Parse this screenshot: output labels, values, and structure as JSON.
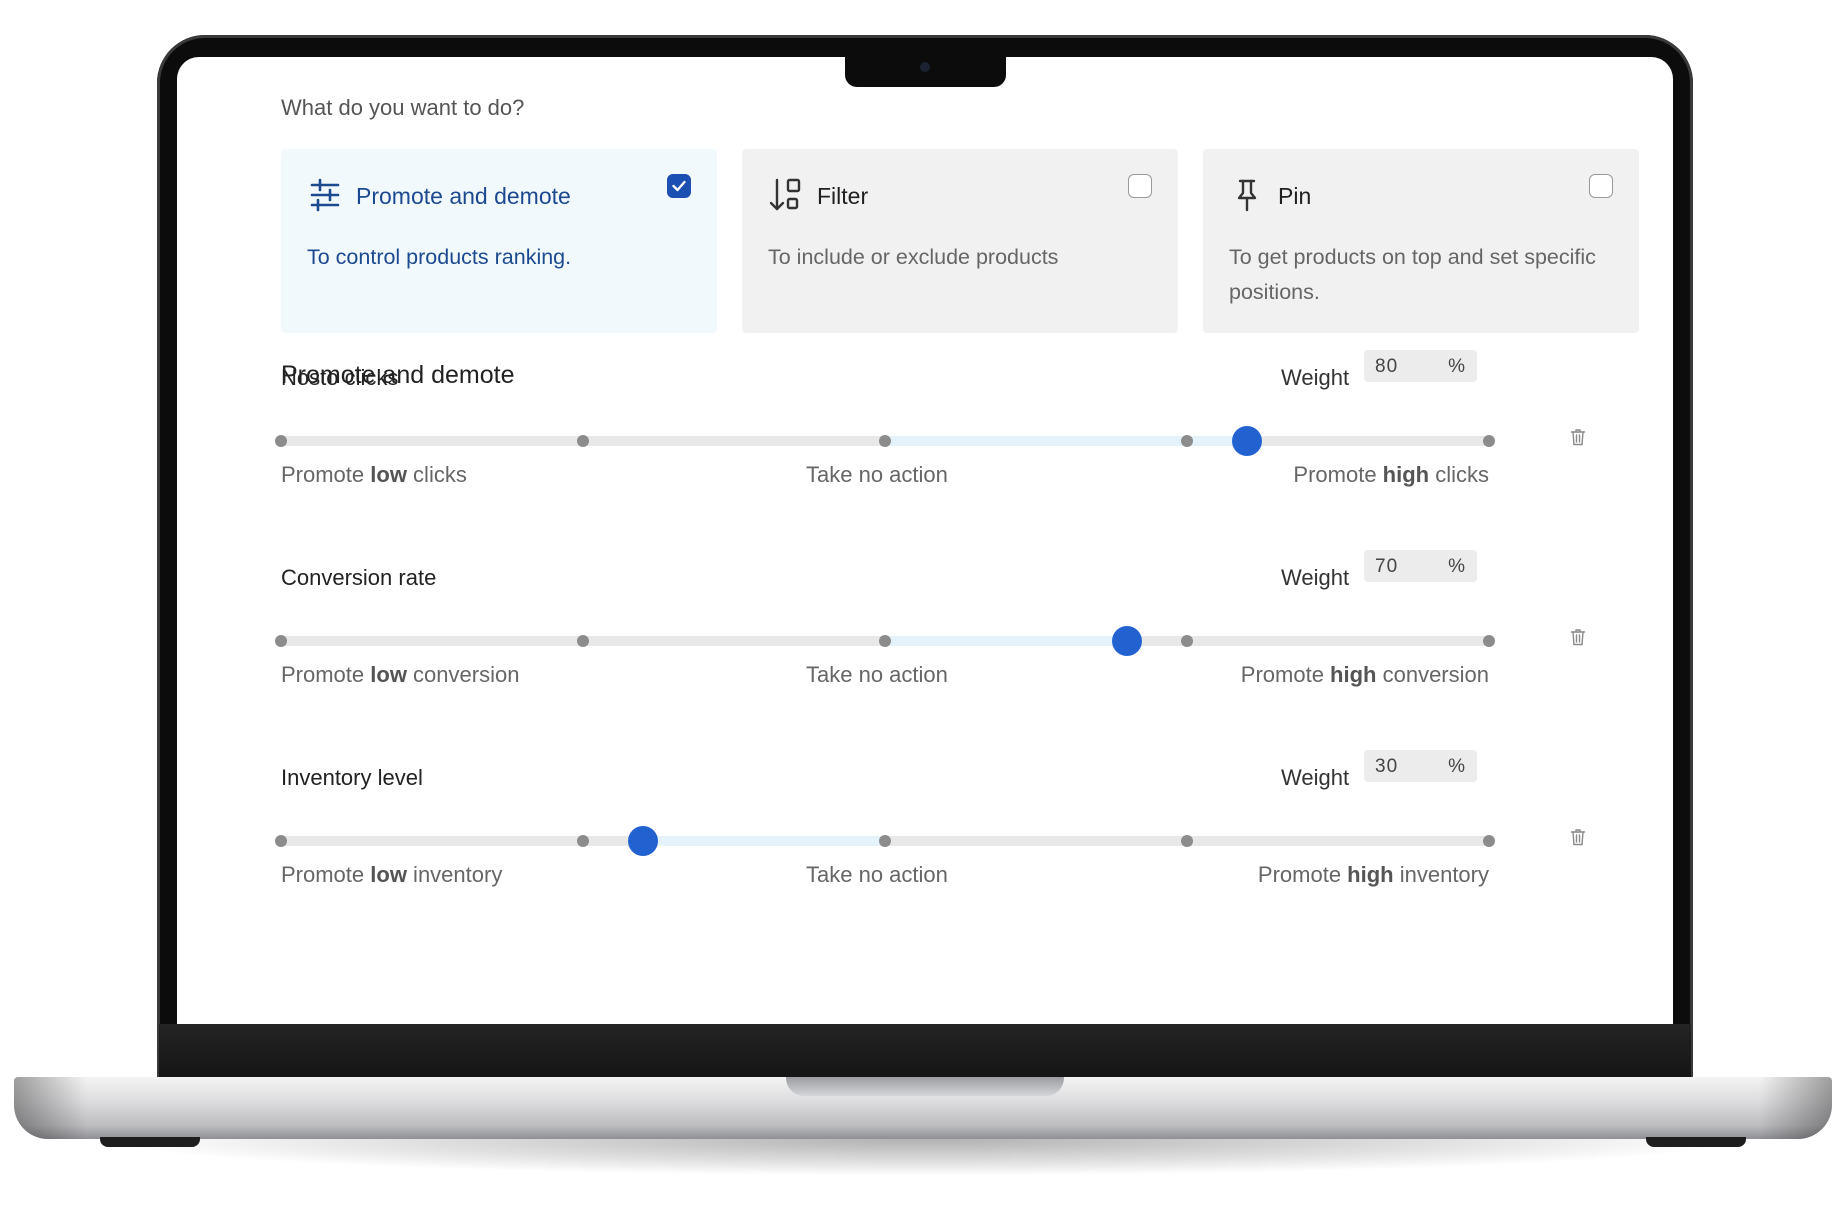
{
  "prompt": "What do you want to do?",
  "cards": [
    {
      "title": "Promote and demote",
      "description": "To control products ranking.",
      "checked": true,
      "icon": "sliders-icon"
    },
    {
      "title": "Filter",
      "description": "To include or exclude products",
      "checked": false,
      "icon": "filter-sort-icon"
    },
    {
      "title": "Pin",
      "description": "To get products on top and set specific positions.",
      "checked": false,
      "icon": "pin-icon"
    }
  ],
  "section_title": "Promote and demote",
  "weight_label": "Weight",
  "weight_unit": "%",
  "factors": [
    {
      "name": "Nosto clicks",
      "weight": "80",
      "level": 0.8,
      "low": {
        "pre": "Promote ",
        "bold": "low",
        "post": " clicks"
      },
      "mid": "Take no action",
      "high": {
        "pre": "Promote ",
        "bold": "high",
        "post": " clicks"
      }
    },
    {
      "name": "Conversion rate",
      "weight": "70",
      "level": 0.7,
      "low": {
        "pre": "Promote ",
        "bold": "low",
        "post": " conversion"
      },
      "mid": "Take no action",
      "high": {
        "pre": "Promote ",
        "bold": "high",
        "post": " conversion"
      }
    },
    {
      "name": "Inventory level",
      "weight": "30",
      "level": 0.3,
      "low": {
        "pre": "Promote ",
        "bold": "low",
        "post": " inventory"
      },
      "mid": "Take no action",
      "high": {
        "pre": "Promote ",
        "bold": "high",
        "post": " inventory"
      }
    }
  ],
  "colors": {
    "accent": "#2262d0",
    "selected_card_bg": "#f2f9fd",
    "selected_text": "#1c4a91"
  }
}
